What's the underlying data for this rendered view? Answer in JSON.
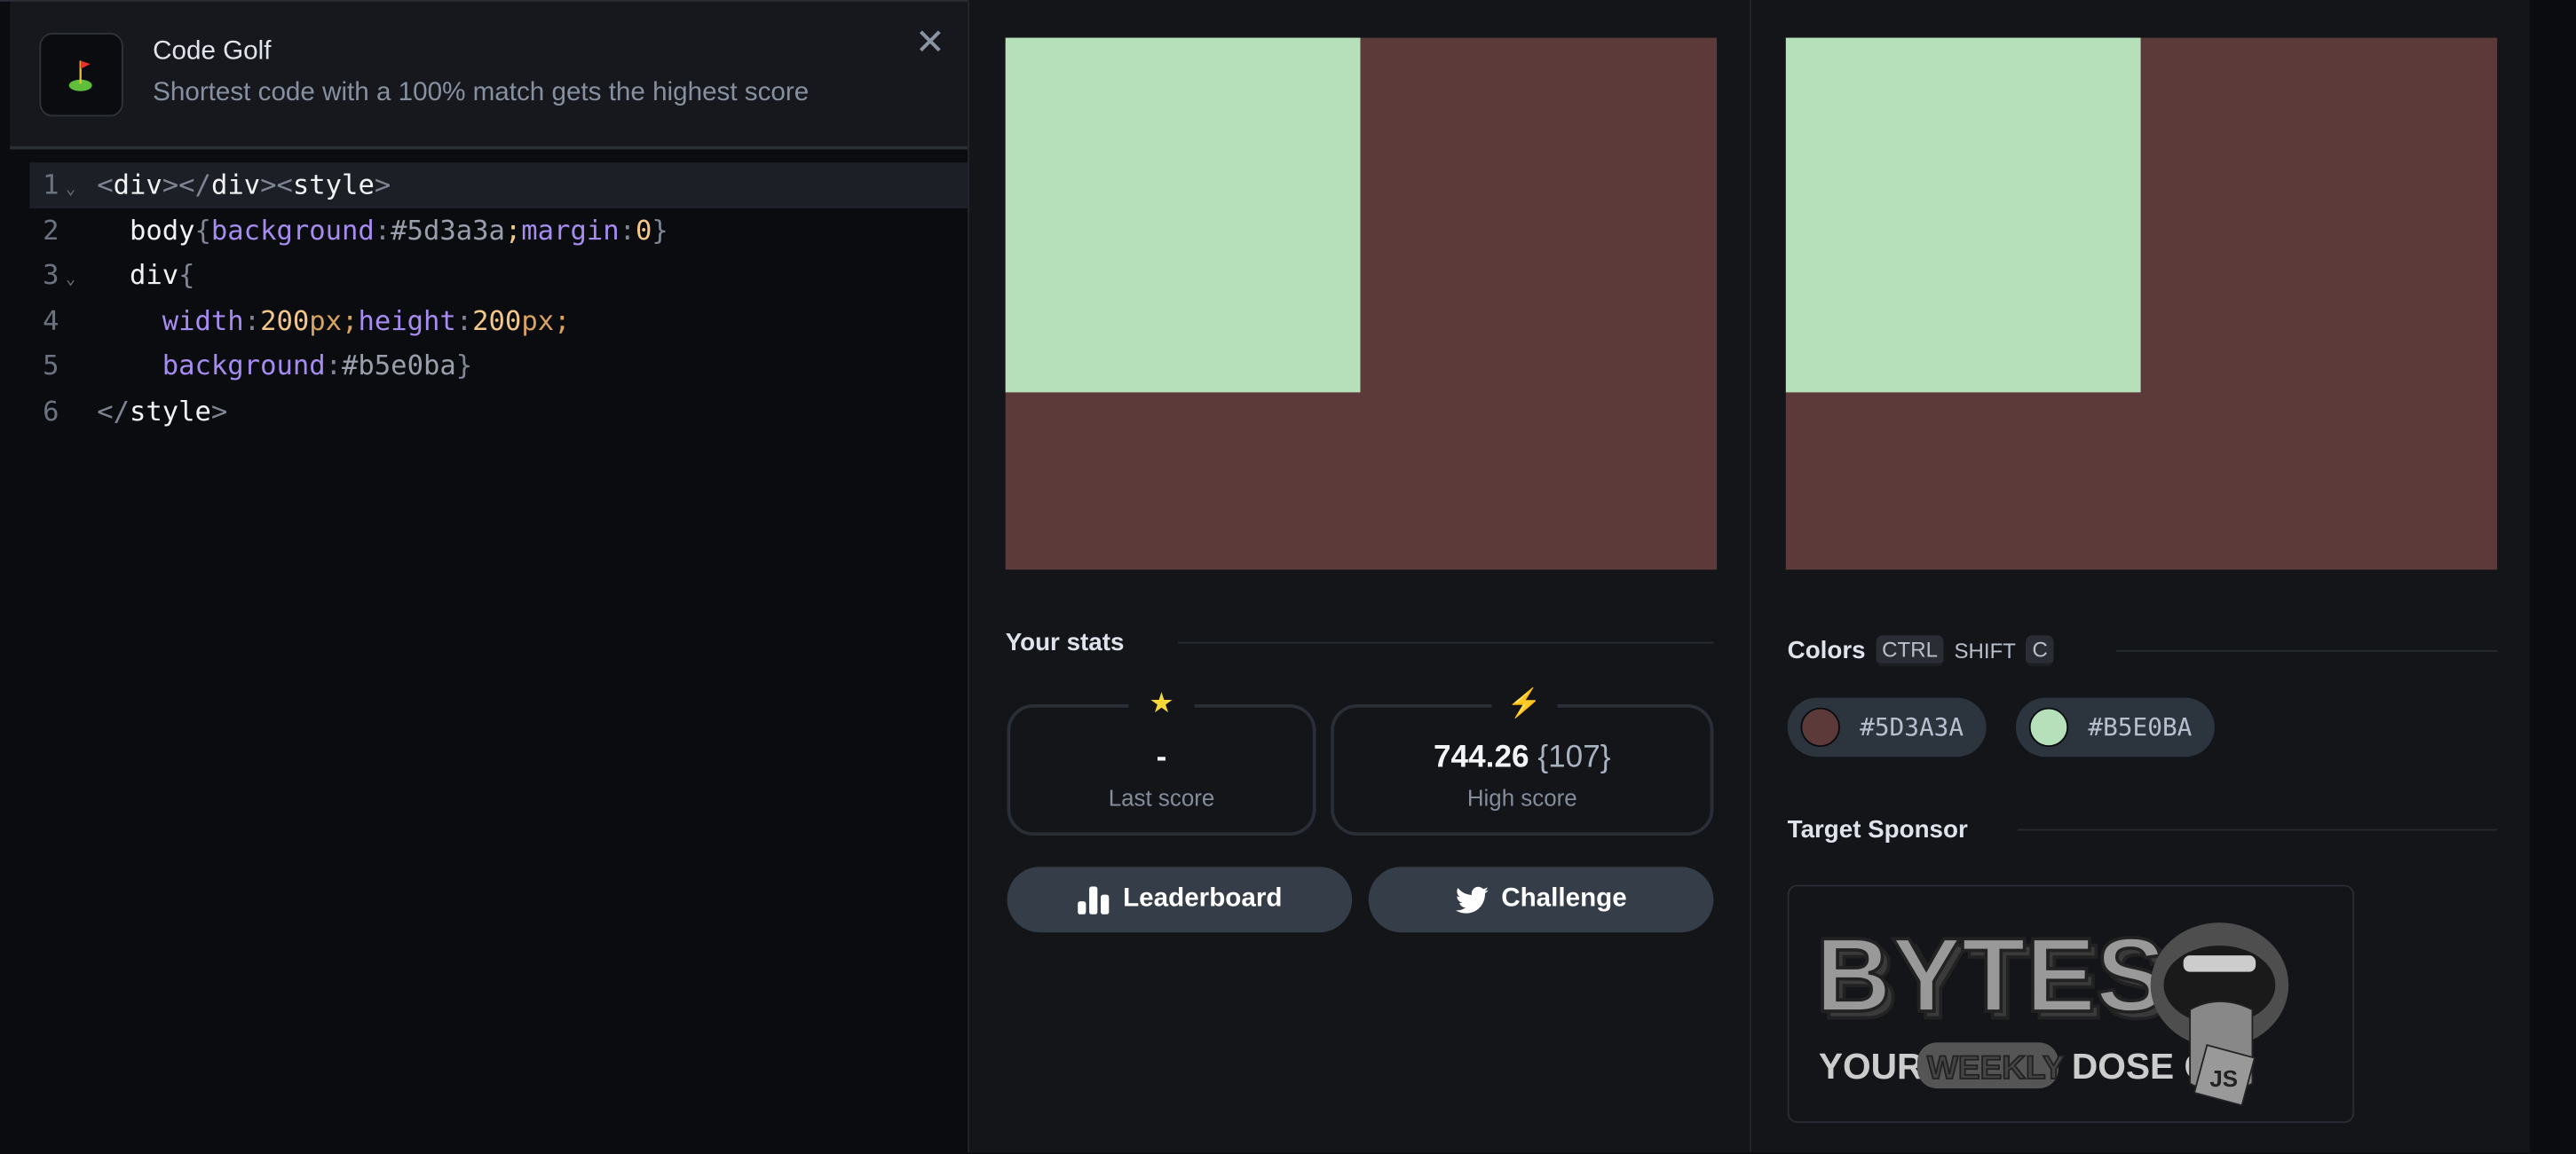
{
  "header": {
    "title": "Code Golf",
    "subtitle": "Shortest code with a 100% match gets the highest score",
    "icon": "golf-flag-icon",
    "close_icon": "close-icon"
  },
  "editor": {
    "lines": [
      {
        "number": "1",
        "foldable": true
      },
      {
        "number": "2",
        "foldable": false
      },
      {
        "number": "3",
        "foldable": true
      },
      {
        "number": "4",
        "foldable": false
      },
      {
        "number": "5",
        "foldable": false
      },
      {
        "number": "6",
        "foldable": false
      }
    ],
    "code": [
      "<div></div><style>",
      "  body{background:#5d3a3a;margin:0}",
      "  div{",
      "    width:200px;height:200px;",
      "    background:#b5e0ba}",
      "</style>"
    ]
  },
  "output_preview": {
    "background": "#5d3a3a",
    "box_color": "#b5e0ba"
  },
  "target_preview": {
    "background": "#5d3a3a",
    "box_color": "#b5e0ba"
  },
  "stats": {
    "heading": "Your stats",
    "last_score": {
      "value": "-",
      "label": "Last score",
      "icon": "star-icon"
    },
    "high_score": {
      "value": "744.26",
      "chars": "{107}",
      "label": "High score",
      "icon": "lightning-icon"
    }
  },
  "buttons": {
    "leaderboard": "Leaderboard",
    "challenge": "Challenge"
  },
  "colors": {
    "heading": "Colors",
    "shortcut": [
      "CTRL",
      "SHIFT",
      "C"
    ],
    "swatches": [
      {
        "hex": "#5D3A3A",
        "color": "#5d3a3a"
      },
      {
        "hex": "#B5E0BA",
        "color": "#b5e0ba"
      }
    ]
  },
  "sponsor": {
    "heading": "Target Sponsor",
    "logo_text": "BYTES YOUR WEEKLY DOSE OF JS"
  }
}
